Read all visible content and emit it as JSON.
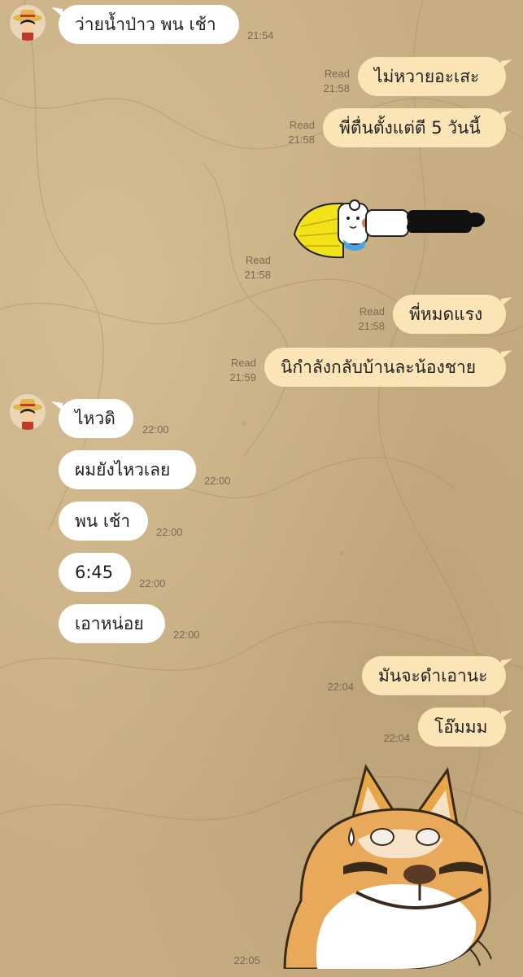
{
  "chat": {
    "messages": [
      {
        "text": "ว่ายน้ำป่าว พน เช้า",
        "time": "21:54"
      },
      {
        "text": "ไม่หวายอะเสะ",
        "read": "Read",
        "time": "21:58"
      },
      {
        "text": "พี่ตื่นตั้งแต่ตี 5 วันนี้",
        "read": "Read",
        "time": "21:58"
      },
      {
        "sticker": "lying-down-character-sticker",
        "read": "Read",
        "time": "21:58"
      },
      {
        "text": "พี่หมดแรง",
        "read": "Read",
        "time": "21:58"
      },
      {
        "text": "นิกำลังกลับบ้านละน้องชาย",
        "read": "Read",
        "time": "21:59"
      },
      {
        "text": "ไหวดิ",
        "time": "22:00"
      },
      {
        "text": "ผมยังไหวเลย",
        "time": "22:00"
      },
      {
        "text": "พน เช้า",
        "time": "22:00"
      },
      {
        "text": "6:45",
        "time": "22:00"
      },
      {
        "text": "เอาหน่อย",
        "time": "22:00"
      },
      {
        "text": "มันจะดำเอานะ",
        "time": "22:04"
      },
      {
        "text": "โอ๊มมม",
        "time": "22:04"
      },
      {
        "sticker": "shiba-dog-smirk-sticker",
        "time": "22:05"
      }
    ]
  },
  "colors": {
    "background": "#c7ad82",
    "incoming_bubble": "#ffffff",
    "outgoing_bubble": "#fbe5b6",
    "meta_text": "#7b6a54"
  },
  "icons": {
    "avatar": "straw-hat-avatar-icon"
  }
}
